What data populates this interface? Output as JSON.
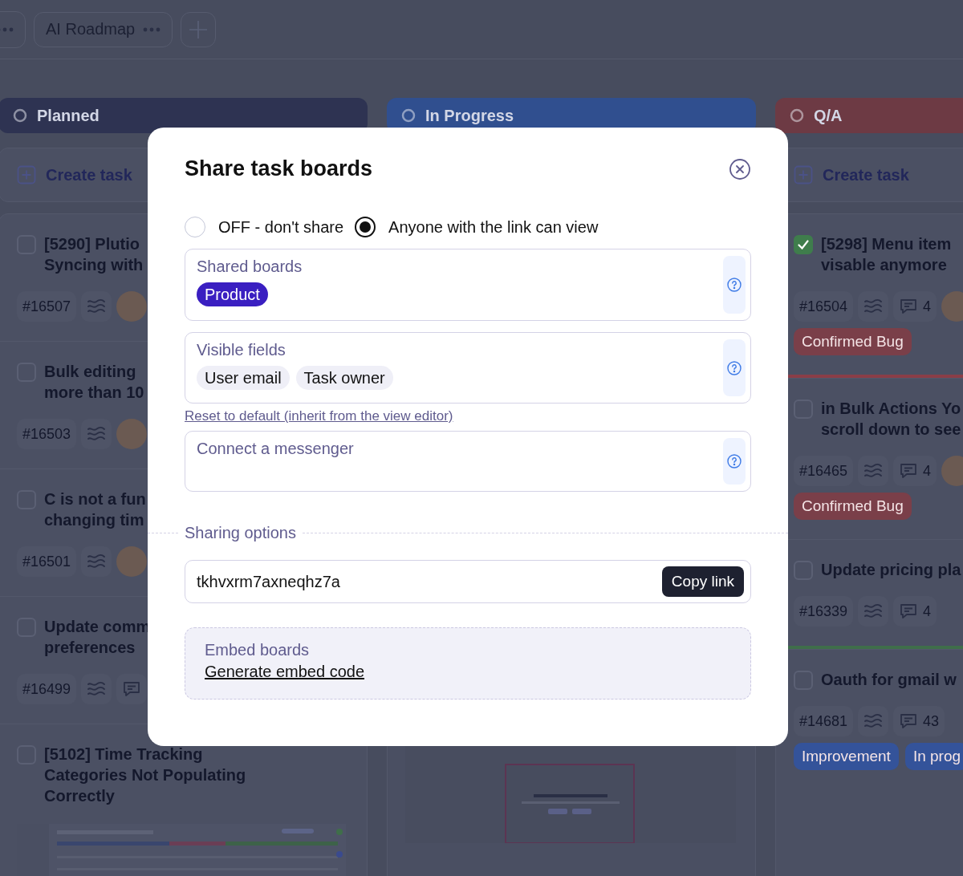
{
  "tabs": [
    {
      "kind": "partial"
    },
    {
      "kind": "full",
      "label": "AI Roadmap"
    }
  ],
  "columns": [
    {
      "title": "Planned",
      "color": "#2e3352",
      "create_label": "Create task",
      "cards": [
        {
          "title_lines": [
            "[5290] Plutio",
            "Syncing with"
          ],
          "checked": false,
          "id": "#16507",
          "has_comments": false,
          "avatar": true
        },
        {
          "title_lines": [
            "Bulk editing",
            "more than 10"
          ],
          "checked": false,
          "id": "#16503",
          "has_comments": false,
          "avatar": true
        },
        {
          "title_lines": [
            "C is not a fun",
            "changing tim"
          ],
          "checked": false,
          "id": "#16501",
          "has_comments": false,
          "avatar": true
        },
        {
          "title_lines": [
            "Update comm",
            "preferences"
          ],
          "checked": false,
          "id": "#16499",
          "has_comments": true,
          "avatar": false
        },
        {
          "title_lines": [
            "[5102] Time Tracking",
            "Categories Not Populating",
            "Correctly"
          ],
          "checked": false,
          "attachment": {
            "kind": "picture"
          }
        }
      ]
    },
    {
      "title": "In Progress",
      "color": "#304f8f",
      "attachment": {
        "kind": "picture"
      }
    },
    {
      "title": "Q/A",
      "color": "#6d3a44",
      "create_label": "Create task",
      "cards": [
        {
          "title_lines": [
            "[5298] Menu item",
            "visable anymore"
          ],
          "checked": true,
          "id": "#16504",
          "has_comments": true,
          "comments": "4",
          "avatar": true,
          "tags": [
            {
              "label": "Confirmed Bug",
              "color": "#7a3f49"
            }
          ]
        },
        {
          "title_lines": [
            "in Bulk Actions Yo",
            "scroll down to see"
          ],
          "checked": false,
          "color": "#8a3e48",
          "id": "#16465",
          "has_comments": true,
          "comments": "4",
          "avatar": true,
          "tags": [
            {
              "label": "Confirmed Bug",
              "color": "#7a3f49"
            }
          ]
        },
        {
          "title_lines": [
            "Update pricing pla"
          ],
          "checked": false,
          "id": "#16339",
          "has_comments": true,
          "comments": "4",
          "avatar": false
        },
        {
          "title_lines": [
            "Oauth for gmail w"
          ],
          "checked": false,
          "color": "#3f6e4a",
          "id": "#14681",
          "has_comments": true,
          "comments": "43",
          "avatar": false,
          "tags": [
            {
              "label": "Improvement",
              "color": "#34539a"
            },
            {
              "label": "In prog",
              "color": "#34539a"
            }
          ]
        }
      ]
    }
  ],
  "dialog": {
    "title": "Share task boards",
    "sharing": [
      {
        "label": "OFF - don't share",
        "selected": false
      },
      {
        "label": "Anyone with the link can view",
        "selected": true
      }
    ],
    "shared_boards": {
      "label": "Shared boards",
      "chips": [
        "Product"
      ]
    },
    "visible_fields": {
      "label": "Visible fields",
      "chips": [
        "User email",
        "Task owner"
      ]
    },
    "reset_link": "Reset to default (inherit from the view editor)",
    "messenger": {
      "label": "Connect a messenger"
    },
    "section": "Sharing options",
    "link_field": {
      "value": "tkhvxrm7axneqhz7a",
      "button": "Copy link"
    },
    "embed": {
      "title": "Embed boards",
      "link": "Generate embed code"
    }
  }
}
